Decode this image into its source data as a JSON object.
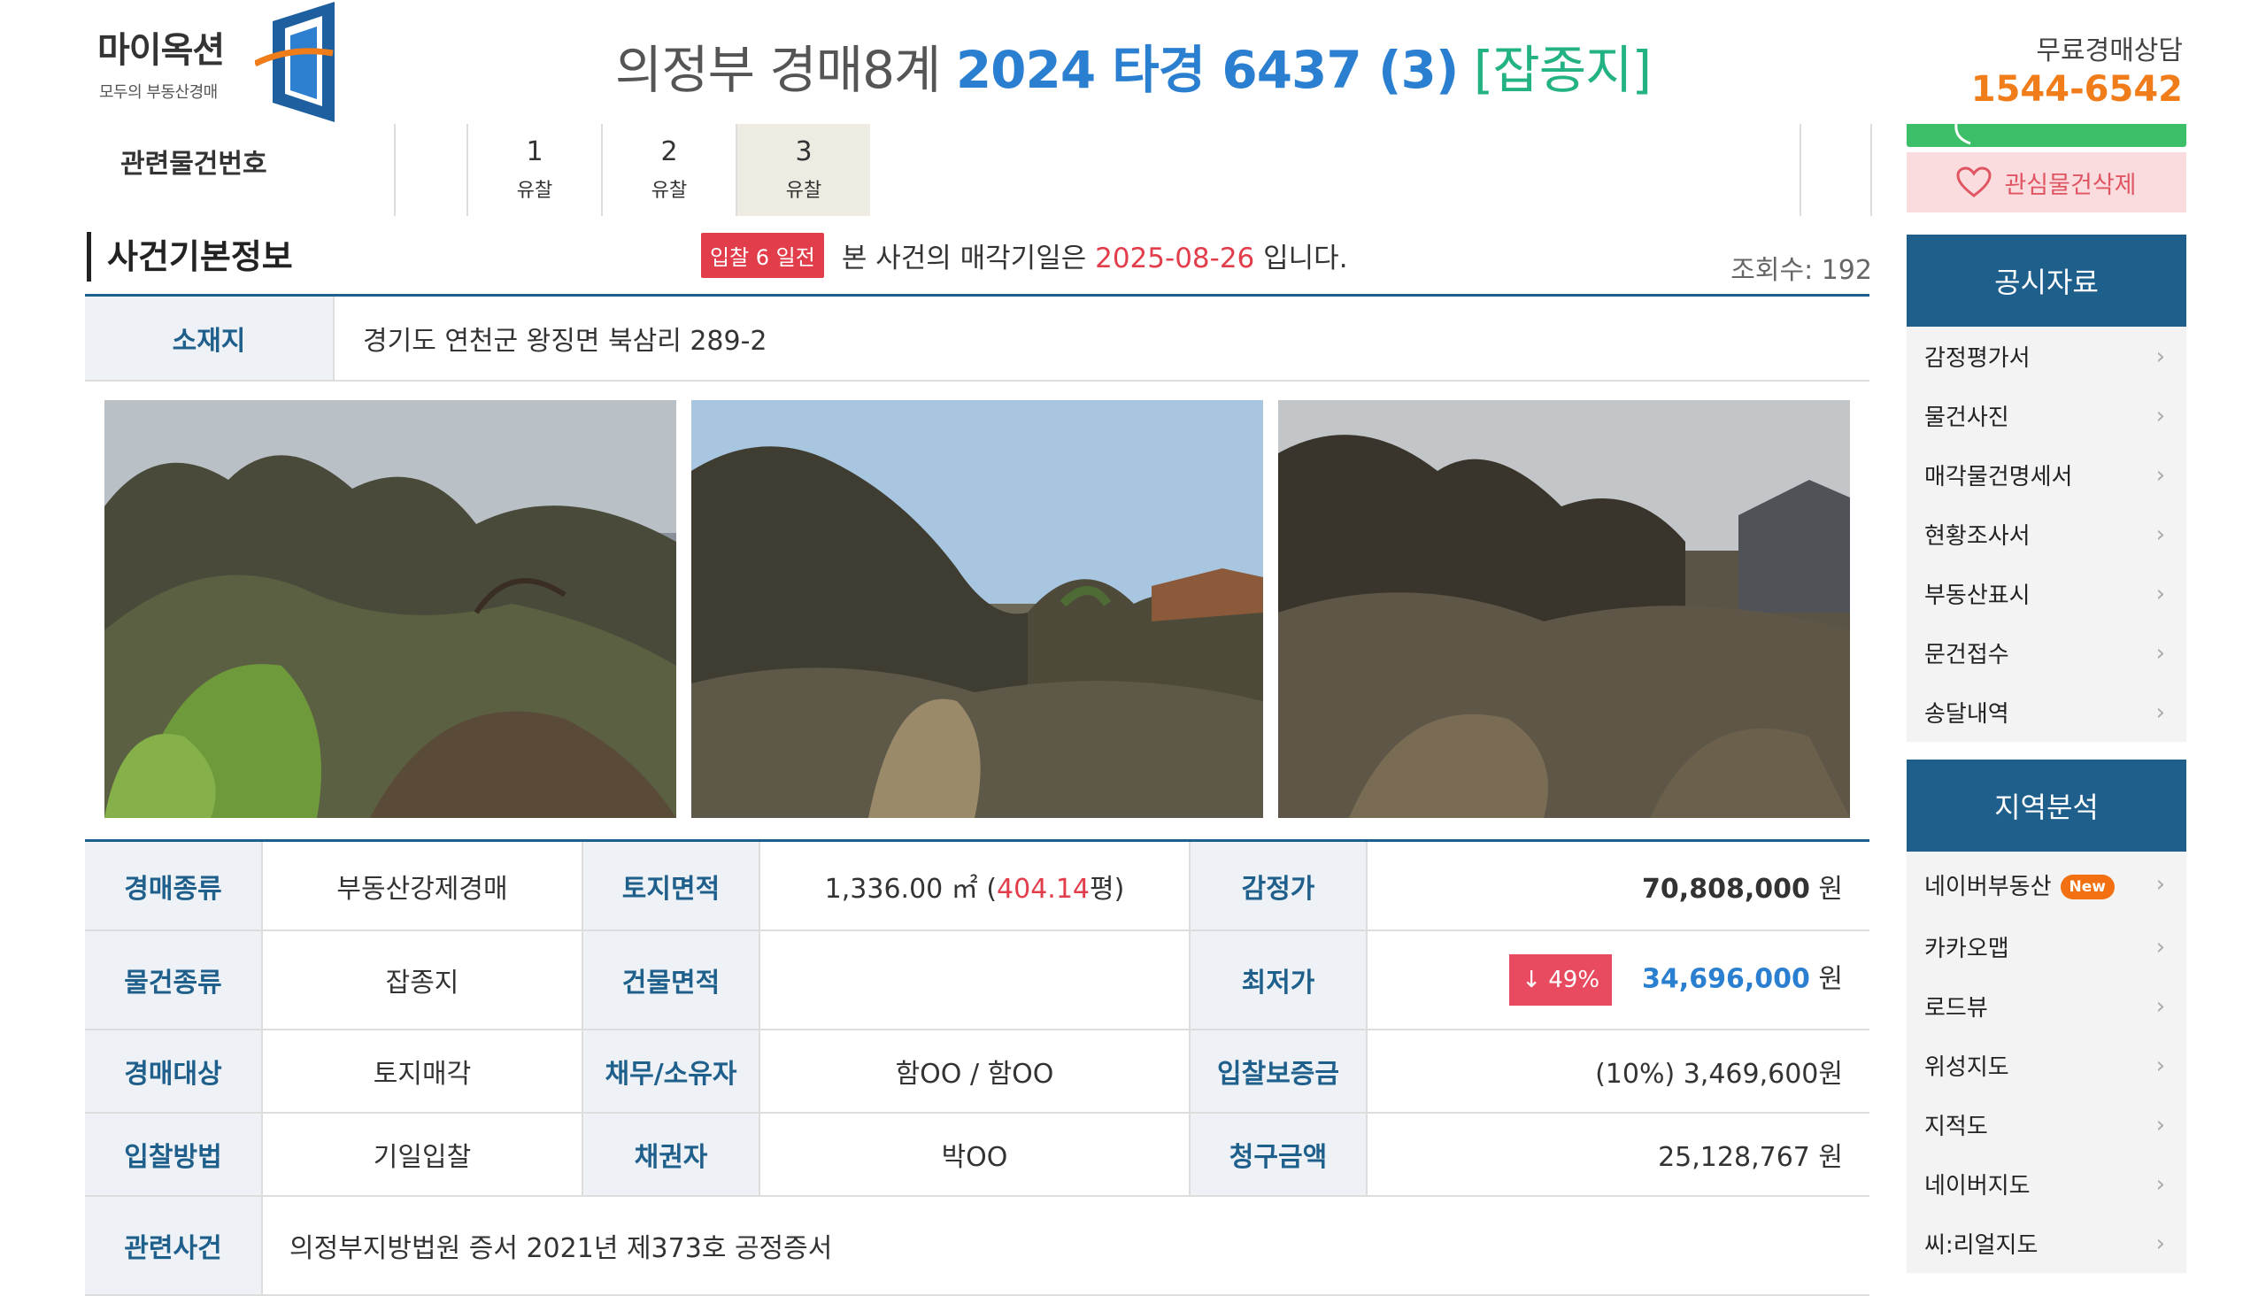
{
  "header": {
    "logo_title": "마이옥션",
    "logo_subtitle": "모두의 부동산경매",
    "court": "의정부 경매8계",
    "case_number": "2024 타경 6437 (3)",
    "property_kind": "[잡종지]",
    "consult_label": "무료경매상담",
    "consult_phone": "1544-6542"
  },
  "related": {
    "label": "관련물건번호",
    "items": [
      {
        "num": "1",
        "status": "유찰"
      },
      {
        "num": "2",
        "status": "유찰"
      },
      {
        "num": "3",
        "status": "유찰"
      }
    ]
  },
  "sidebar": {
    "delete_interest_label": "관심물건삭제",
    "notice_title": "공시자료",
    "notice_items": [
      "감정평가서",
      "물건사진",
      "매각물건명세서",
      "현황조사서",
      "부동산표시",
      "문건접수",
      "송달내역"
    ],
    "region_title": "지역분석",
    "region_items": [
      {
        "label": "네이버부동산",
        "badge": "New"
      },
      {
        "label": "카카오맵",
        "badge": ""
      },
      {
        "label": "로드뷰",
        "badge": ""
      },
      {
        "label": "위성지도",
        "badge": ""
      },
      {
        "label": "지적도",
        "badge": ""
      },
      {
        "label": "네이버지도",
        "badge": ""
      },
      {
        "label": "씨:리얼지도",
        "badge": ""
      }
    ]
  },
  "case_info": {
    "section_title": "사건기본정보",
    "dday": "입찰 6 일전",
    "notice_prefix": "본 사건의 매각기일은",
    "sale_date": "2025-08-26",
    "notice_suffix": "입니다.",
    "views": "조회수: 192",
    "address_label": "소재지",
    "address": "경기도 연천군 왕징면 북삼리 289-2"
  },
  "details": {
    "auction_type_label": "경매종류",
    "auction_type": "부동산강제경매",
    "land_area_label": "토지면적",
    "land_area_m2": "1,336.00 ㎡ (",
    "land_area_pyeong": "404.14",
    "land_area_suffix": "평)",
    "appraisal_label": "감정가",
    "appraisal_value": "70,808,000",
    "won": "원",
    "item_type_label": "물건종류",
    "item_type": "잡종지",
    "building_area_label": "건물면적",
    "building_area": "",
    "min_price_label": "최저가",
    "min_price_drop": "↓ 49%",
    "min_price_value": "34,696,000",
    "target_label": "경매대상",
    "target": "토지매각",
    "owner_label": "채무/소유자",
    "owner": "함OO / 함OO",
    "deposit_label": "입찰보증금",
    "deposit": "(10%) 3,469,600원",
    "bid_method_label": "입찰방법",
    "bid_method": "기일입찰",
    "creditor_label": "채권자",
    "creditor": "박OO",
    "claim_label": "청구금액",
    "claim": "25,128,767 원",
    "related_case_label": "관련사건",
    "related_case": "의정부지방법원 증서 2021년 제373호 공정증서"
  },
  "colors": {
    "primary": "#1f5f8b",
    "case_blue": "#2b7fd0",
    "kind_green": "#22b283",
    "phone_orange": "#f07c1a",
    "alert_red": "#e23d4b"
  }
}
